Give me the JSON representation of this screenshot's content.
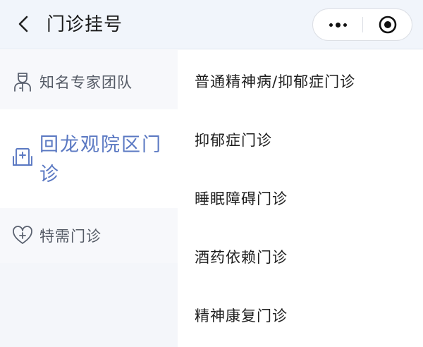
{
  "header": {
    "back_icon": "chevron-left-icon",
    "title": "门诊挂号",
    "capsule": {
      "more_icon": "more-dots-icon",
      "close_icon": "target-circle-icon"
    }
  },
  "sidebar": {
    "active_index": 1,
    "active_color": "#5a78c2",
    "items": [
      {
        "label": "知名专家团队",
        "icon": "doctor-icon"
      },
      {
        "label": "回龙观院区门诊",
        "icon": "hospital-building-icon"
      },
      {
        "label": "特需门诊",
        "icon": "heart-care-icon"
      }
    ]
  },
  "departments": [
    "普通精神病/抑郁症门诊",
    "抑郁症门诊",
    "睡眠障碍门诊",
    "酒药依赖门诊",
    "精神康复门诊"
  ]
}
